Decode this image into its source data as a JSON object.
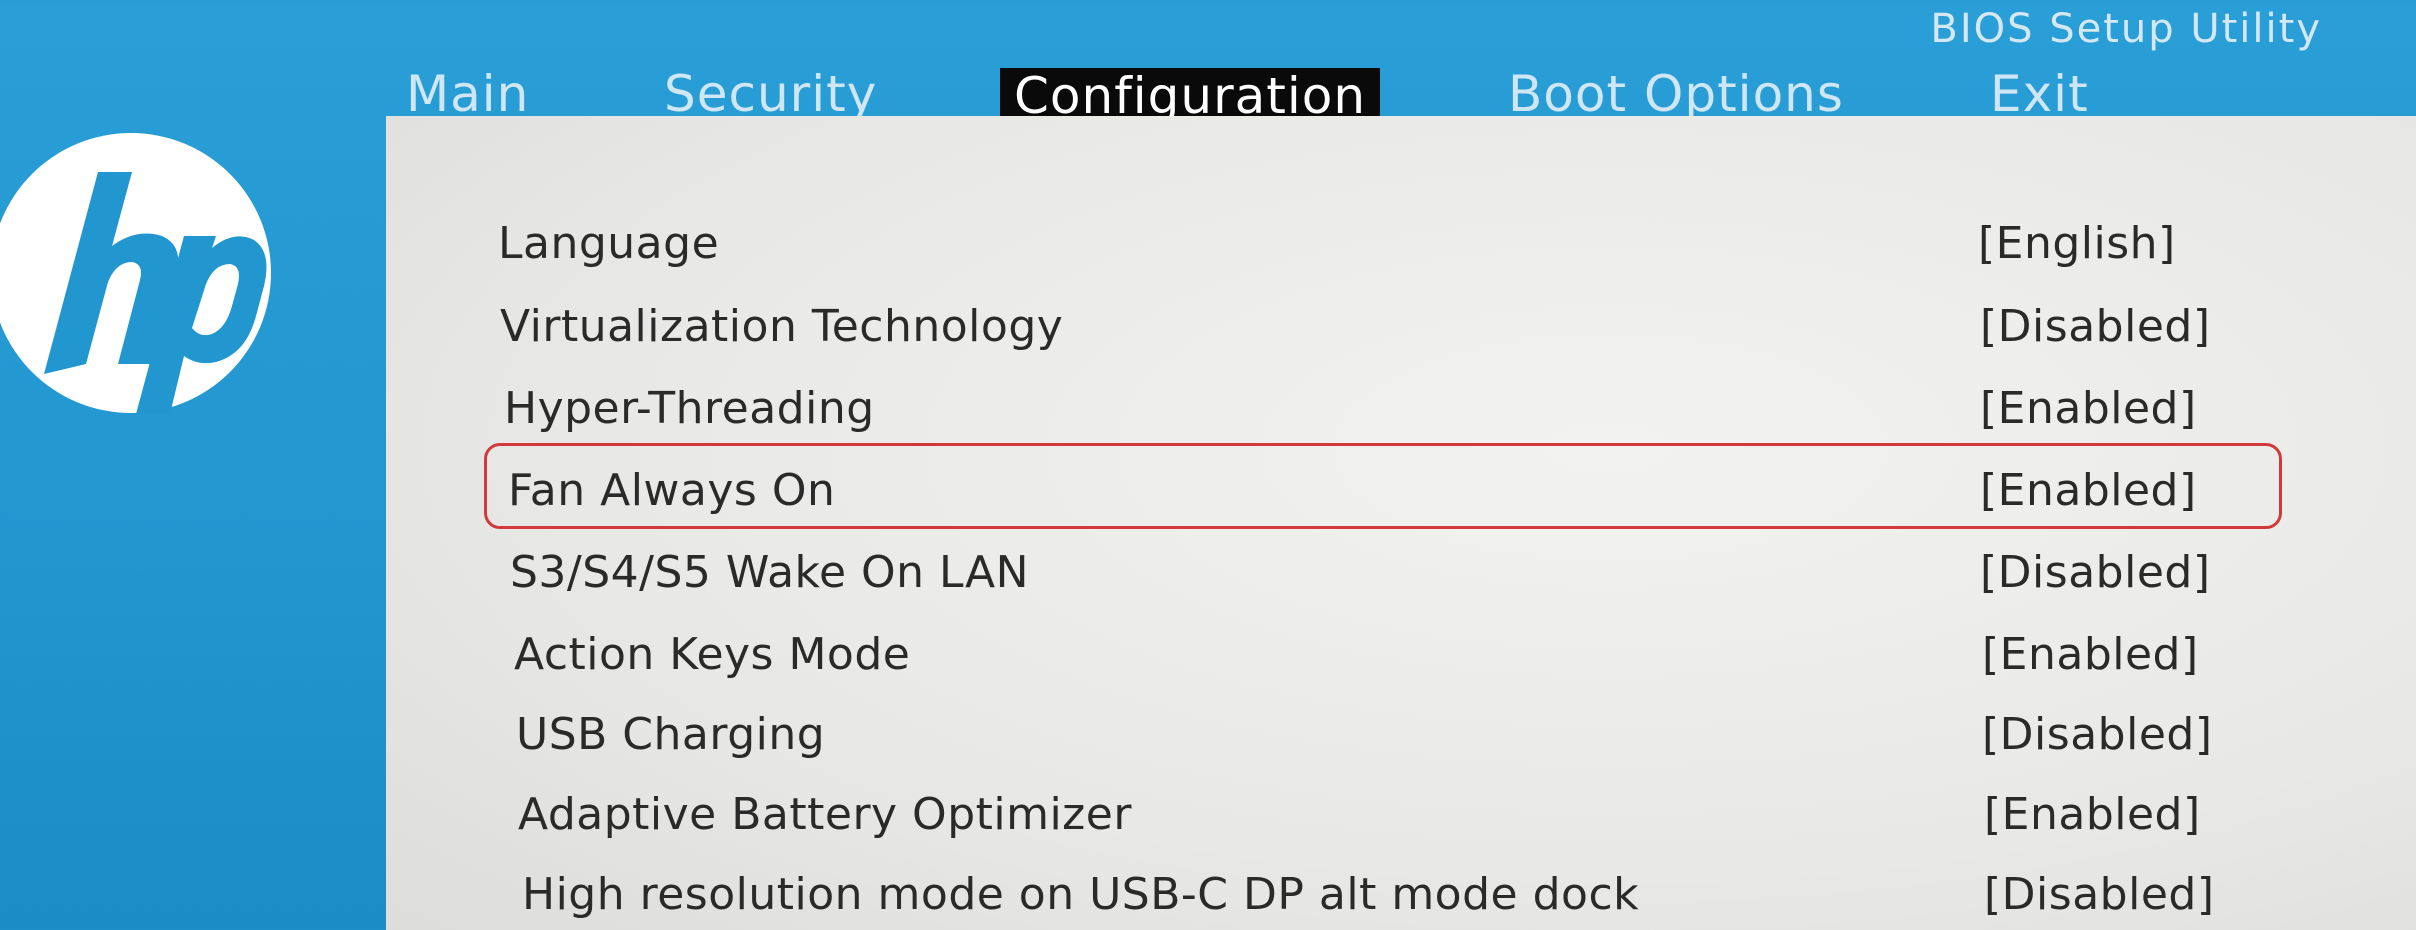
{
  "header": {
    "utility_title": "BIOS Setup Utility"
  },
  "menu": {
    "tabs": [
      {
        "label": "Main",
        "active": false
      },
      {
        "label": "Security",
        "active": false
      },
      {
        "label": "Configuration",
        "active": true
      },
      {
        "label": "Boot Options",
        "active": false
      },
      {
        "label": "Exit",
        "active": false
      }
    ]
  },
  "brand": {
    "logo_icon": "hp-logo-icon",
    "logo_text": "hp"
  },
  "settings": [
    {
      "label": "Language",
      "value": "[English]"
    },
    {
      "label": "Virtualization Technology",
      "value": "[Disabled]"
    },
    {
      "label": "Hyper-Threading",
      "value": "[Enabled]"
    },
    {
      "label": "Fan Always On",
      "value": "[Enabled]",
      "highlighted": true
    },
    {
      "label": "S3/S4/S5 Wake On LAN",
      "value": "[Disabled]"
    },
    {
      "label": "Action Keys Mode",
      "value": "[Enabled]"
    },
    {
      "label": "USB Charging",
      "value": "[Disabled]"
    },
    {
      "label": "Adaptive Battery Optimizer",
      "value": "[Enabled]"
    },
    {
      "label": "High resolution mode on USB-C DP alt mode dock",
      "value": "[Disabled]"
    }
  ],
  "colors": {
    "background": "#2196cf",
    "panel": "#ececea",
    "active_tab_bg": "#0a0a0a",
    "highlight_border": "#d23a3a"
  }
}
